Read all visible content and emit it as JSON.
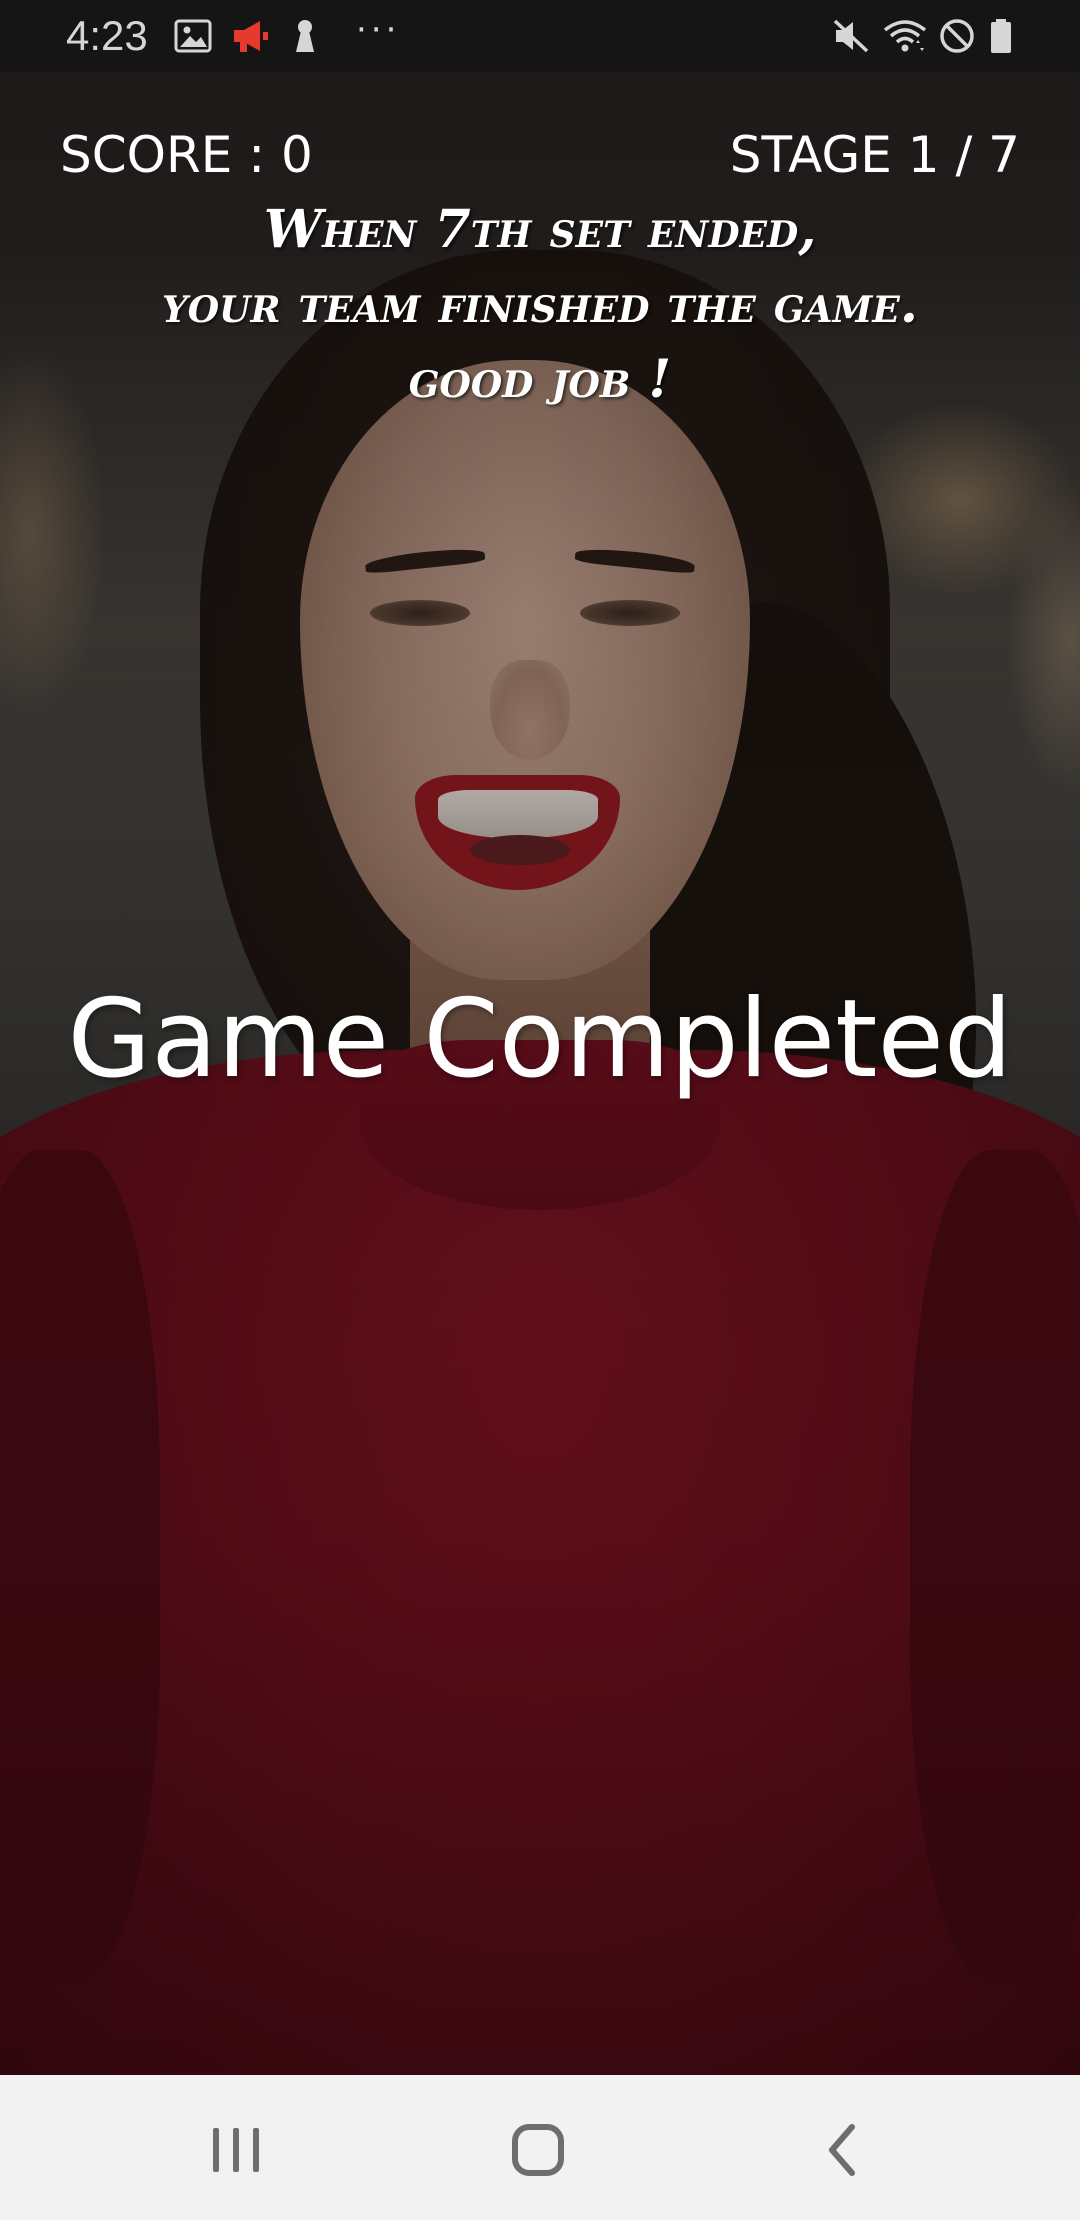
{
  "status_bar": {
    "time": "4:23",
    "more_indicator": "···",
    "left_icons": [
      "gallery-icon",
      "megaphone-icon",
      "keyhole-icon",
      "more-icon"
    ],
    "right_icons": [
      "mute-icon",
      "wifi-icon",
      "do-not-disturb-icon",
      "battery-icon"
    ],
    "megaphone_color": "#e53a2c"
  },
  "hud": {
    "score_label": "SCORE : 0",
    "stage_label": "STAGE 1 / 7"
  },
  "message": {
    "lines": [
      "When 7th set ended,",
      "your team finished the game.",
      "good job !"
    ]
  },
  "result": {
    "title": "Game Completed"
  },
  "nav_bar": {
    "buttons": [
      "recents-button",
      "home-button",
      "back-button"
    ],
    "background": "#f2f2f2",
    "icon_color": "#6e6e6e"
  },
  "colors": {
    "sweater": "#6b0f1d",
    "text": "#ffffff"
  }
}
